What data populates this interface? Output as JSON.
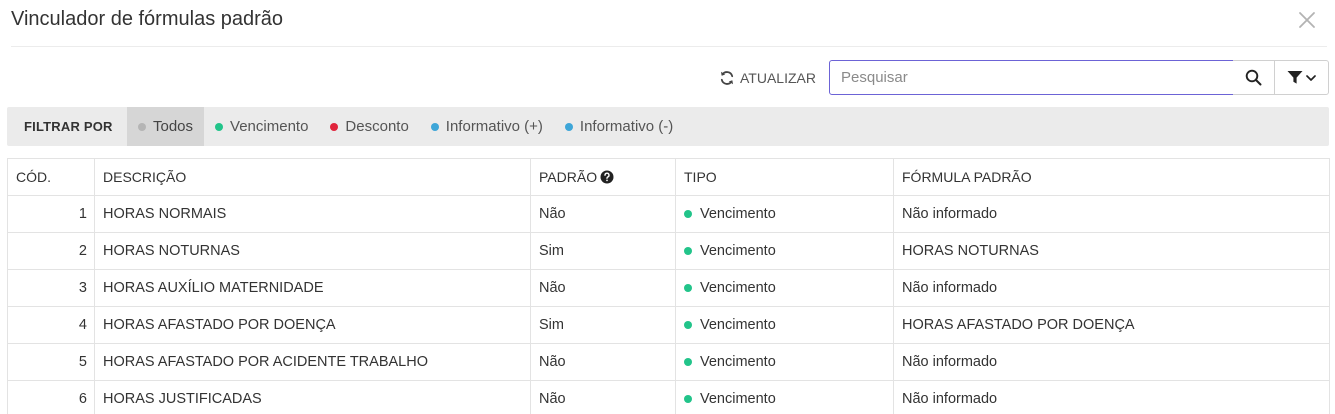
{
  "dialog": {
    "title": "Vinculador de fórmulas padrão"
  },
  "toolbar": {
    "refresh_label": "ATUALIZAR",
    "search_placeholder": "Pesquisar",
    "search_value": ""
  },
  "filter": {
    "label": "FILTRAR POR",
    "options": [
      {
        "label": "Todos",
        "color": "#b5b5b5",
        "active": true
      },
      {
        "label": "Vencimento",
        "color": "#22c48a",
        "active": false
      },
      {
        "label": "Desconto",
        "color": "#e0243c",
        "active": false
      },
      {
        "label": "Informativo (+)",
        "color": "#3ea6d8",
        "active": false
      },
      {
        "label": "Informativo (-)",
        "color": "#3ea6d8",
        "active": false
      }
    ]
  },
  "table": {
    "columns": [
      "CÓD.",
      "DESCRIÇÃO",
      "PADRÃO",
      "TIPO",
      "FÓRMULA PADRÃO"
    ],
    "rows": [
      {
        "cod": "1",
        "descricao": "HORAS NORMAIS",
        "padrao": "Não",
        "tipo": "Vencimento",
        "tipo_color": "#22c48a",
        "formula": "Não informado"
      },
      {
        "cod": "2",
        "descricao": "HORAS NOTURNAS",
        "padrao": "Sim",
        "tipo": "Vencimento",
        "tipo_color": "#22c48a",
        "formula": "HORAS NOTURNAS"
      },
      {
        "cod": "3",
        "descricao": "HORAS AUXÍLIO MATERNIDADE",
        "padrao": "Não",
        "tipo": "Vencimento",
        "tipo_color": "#22c48a",
        "formula": "Não informado"
      },
      {
        "cod": "4",
        "descricao": "HORAS AFASTADO POR DOENÇA",
        "padrao": "Sim",
        "tipo": "Vencimento",
        "tipo_color": "#22c48a",
        "formula": "HORAS AFASTADO POR DOENÇA"
      },
      {
        "cod": "5",
        "descricao": "HORAS AFASTADO POR ACIDENTE TRABALHO",
        "padrao": "Não",
        "tipo": "Vencimento",
        "tipo_color": "#22c48a",
        "formula": "Não informado"
      },
      {
        "cod": "6",
        "descricao": "HORAS JUSTIFICADAS",
        "padrao": "Não",
        "tipo": "Vencimento",
        "tipo_color": "#22c48a",
        "formula": "Não informado"
      }
    ]
  },
  "icons": {
    "close": "close-icon",
    "refresh": "refresh-icon",
    "search": "search-icon",
    "filter": "filter-icon",
    "dropdown": "chevron-down-icon",
    "help": "help-icon"
  },
  "colors": {
    "accent_border": "#6c63d6",
    "vencimento": "#22c48a",
    "desconto": "#e0243c",
    "informativo": "#3ea6d8",
    "todos": "#b5b5b5"
  }
}
